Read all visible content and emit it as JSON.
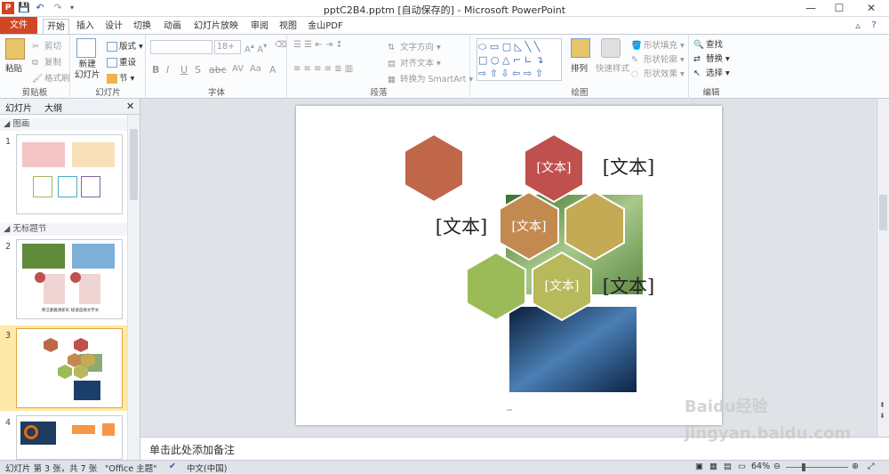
{
  "titlebar": {
    "title": "pptC2B4.pptm [自动保存的] - Microsoft PowerPoint",
    "logo": "P"
  },
  "tabs": [
    "文件",
    "开始",
    "插入",
    "设计",
    "切换",
    "动画",
    "幻灯片放映",
    "审阅",
    "视图",
    "金山PDF"
  ],
  "ribbon": {
    "clipboard": {
      "label": "剪贴板",
      "paste": "粘贴",
      "cut": "剪切",
      "copy": "复制",
      "format_painter": "格式刷"
    },
    "slides": {
      "label": "幻灯片",
      "new_slide": "新建\n幻灯片",
      "layout": "版式",
      "reset": "重设",
      "section": "节"
    },
    "font": {
      "label": "字体",
      "size": "18+"
    },
    "paragraph": {
      "label": "段落",
      "text_direction": "文字方向",
      "align_text": "对齐文本",
      "smartart": "转换为 SmartArt"
    },
    "drawing": {
      "label": "绘图",
      "arrange": "排列",
      "quick_styles": "快速样式",
      "shape_fill": "形状填充",
      "shape_outline": "形状轮廓",
      "shape_effects": "形状效果"
    },
    "editing": {
      "label": "编辑",
      "find": "查找",
      "replace": "替换",
      "select": "选择"
    }
  },
  "panel": {
    "tab_slides": "幻灯片",
    "tab_outline": "大纲",
    "section1": "图画",
    "section2": "无标题节",
    "slide_numbers": [
      "1",
      "2",
      "3",
      "4"
    ],
    "slide2_caption": "简洁素雅清新彩   极速选择文字文"
  },
  "slide": {
    "hex_labels": [
      "[文本]",
      "[文本]",
      "[文本]"
    ],
    "side_labels": [
      "[文本]",
      "[文本]",
      "[文本]"
    ]
  },
  "notes_placeholder": "单击此处添加备注",
  "status": {
    "slide_info": "幻灯片 第 3 张，共 7 张",
    "theme": "\"Office 主题\"",
    "language": "中文(中国)",
    "zoom": "64%"
  },
  "colors": {
    "accent": "#d24625",
    "hex_brown": "#c0674a",
    "hex_red": "#c0504d",
    "hex_orange": "#c38a4f",
    "hex_gold": "#c4aa55",
    "hex_green": "#9bbb59",
    "hex_olive": "#b7b95a"
  },
  "watermark": "Baidu经验 jingyan.baidu.com"
}
